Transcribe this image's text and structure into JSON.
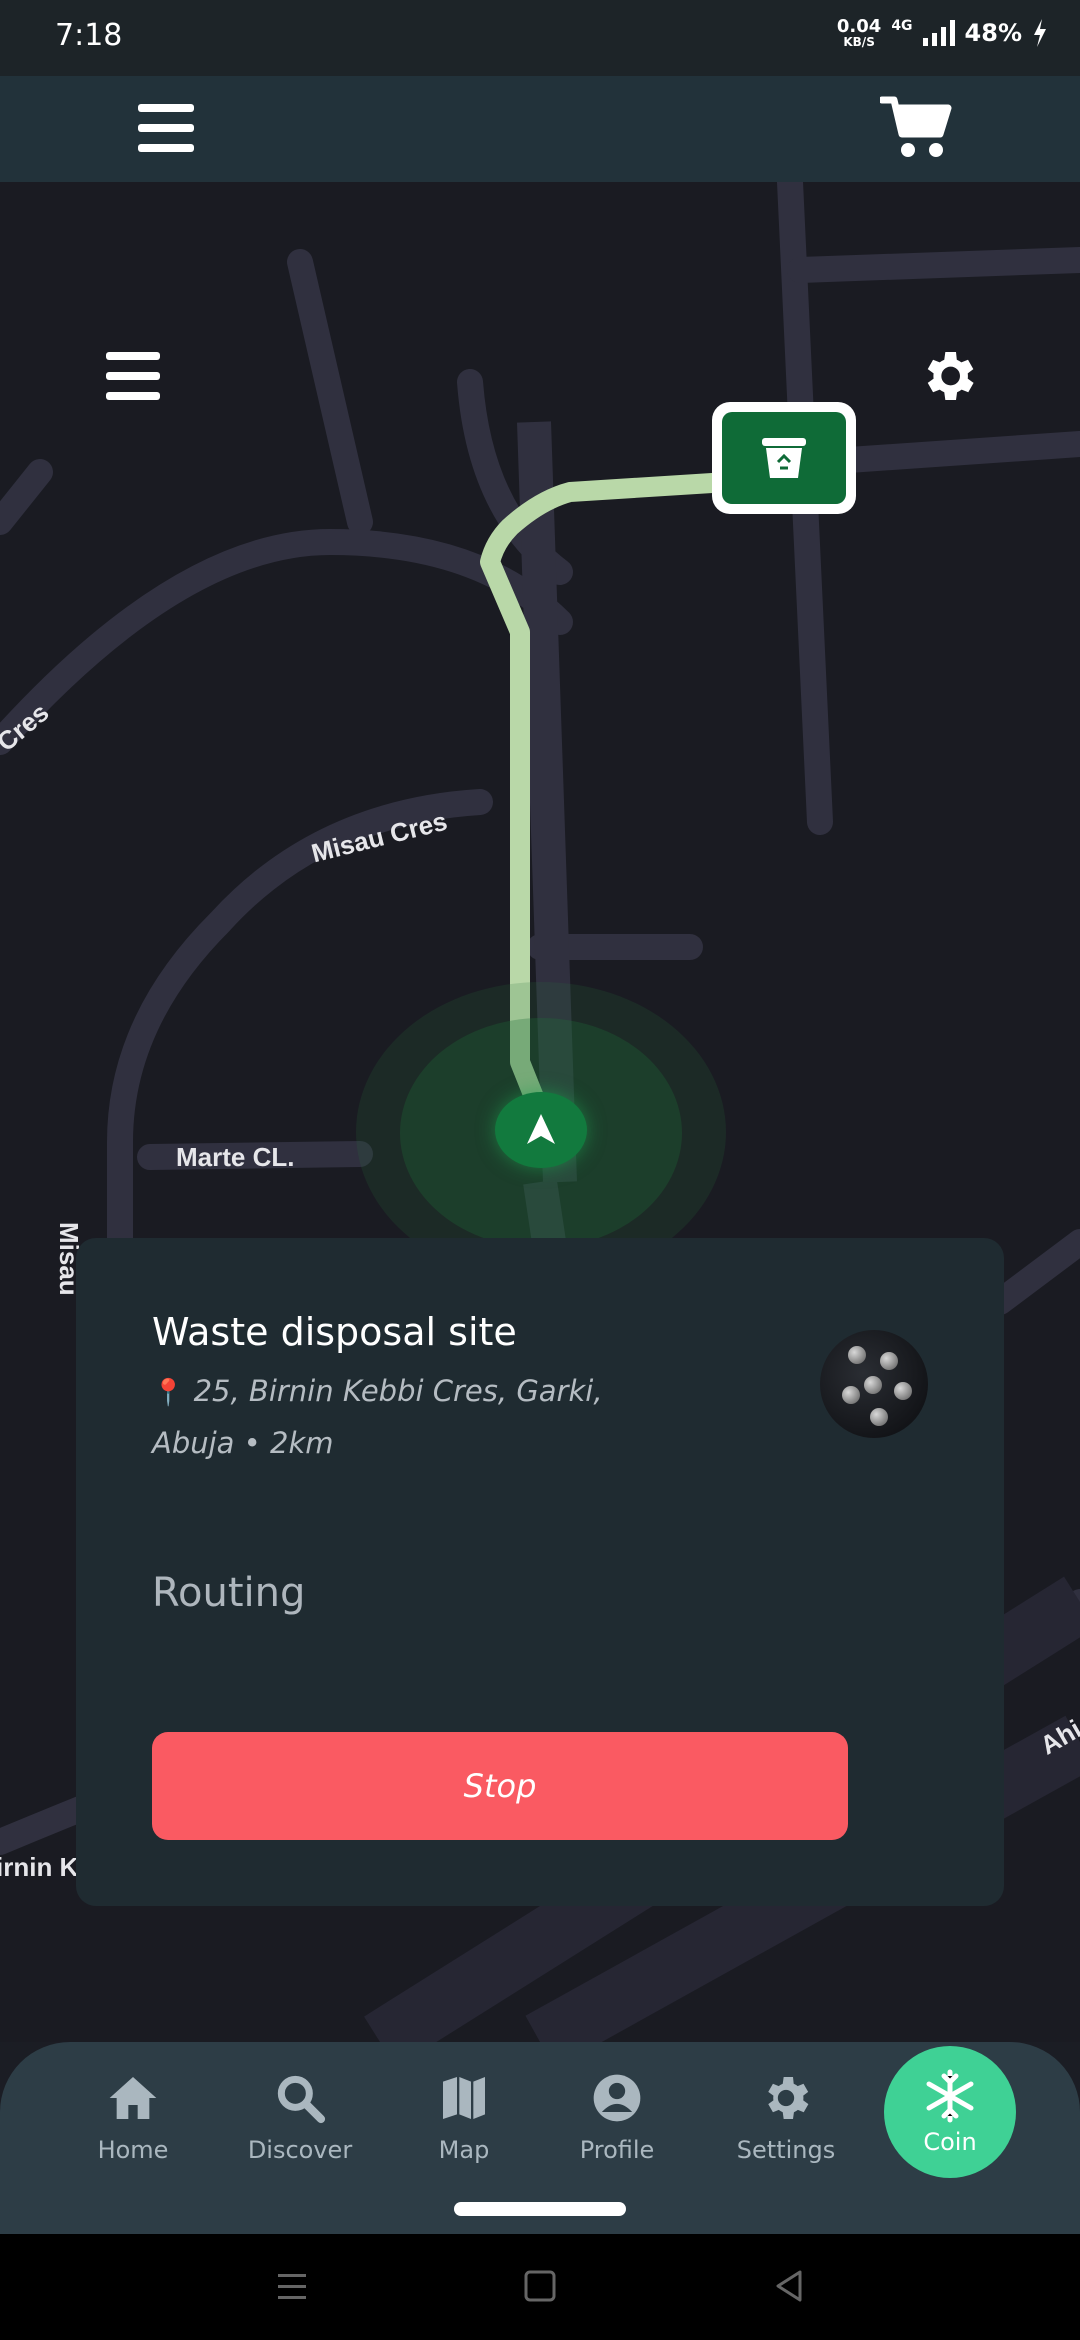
{
  "status_bar": {
    "time": "7:18",
    "net_speed_value": "0.04",
    "net_speed_unit": "KB/S",
    "network_type": "4G",
    "battery": "48%"
  },
  "map": {
    "streets": [
      "Misau Cres",
      "Marte CL.",
      "Misau",
      "Cres",
      "Ahi",
      "irnin K"
    ]
  },
  "destination": {
    "title": "Waste disposal site",
    "address": "25, Birnin Kebbi Cres, Garki, Abuja • 2km",
    "status": "Routing",
    "stop_label": "Stop"
  },
  "bottom_nav": {
    "items": [
      {
        "label": "Home",
        "icon": "home-icon"
      },
      {
        "label": "Discover",
        "icon": "search-icon"
      },
      {
        "label": "Map",
        "icon": "map-icon"
      },
      {
        "label": "Profile",
        "icon": "profile-icon"
      },
      {
        "label": "Settings",
        "icon": "gear-icon"
      }
    ],
    "coin_label": "Coin"
  },
  "colors": {
    "accent_green": "#3fd195",
    "stop_red": "#fa5a62",
    "route_green": "#b9d8a8",
    "marker_green": "#0f6b37"
  }
}
